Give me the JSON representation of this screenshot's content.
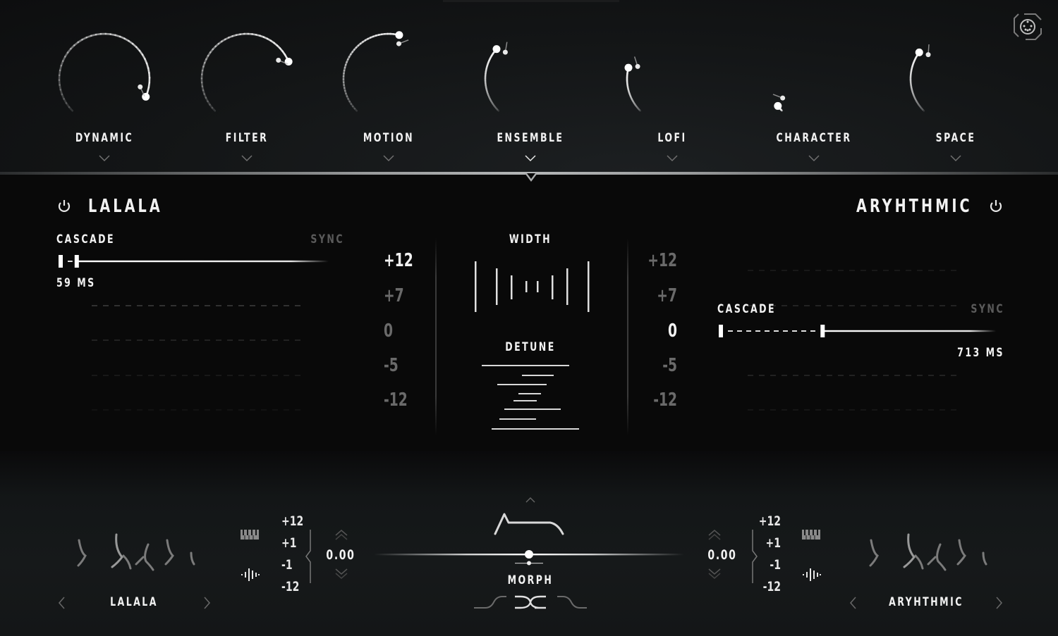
{
  "knobs": [
    {
      "label": "DYNAMIC",
      "value": 0.92,
      "secondary": 0.88
    },
    {
      "label": "FILTER",
      "value": 0.75,
      "secondary": 0.72
    },
    {
      "label": "MOTION",
      "value": 0.55,
      "secondary": 0.56
    },
    {
      "label": "ENSEMBLE",
      "value": 0.32,
      "secondary": 0.34
    },
    {
      "label": "LOFI",
      "value": 0.22,
      "secondary": 0.24
    },
    {
      "label": "CHARACTER",
      "value": 0.03,
      "secondary": 0.05
    },
    {
      "label": "SPACE",
      "value": 0.3,
      "secondary": 0.32
    }
  ],
  "selected_knob": "ENSEMBLE",
  "settings_icon": "midi-connector-icon",
  "left_layer": {
    "name": "LALALA",
    "power_icon": "power-icon",
    "cascade_label": "CASCADE",
    "sync_label": "SYNC",
    "cascade_value": "59 MS",
    "cascade_position": 0.06,
    "pitch_steps": [
      "+12",
      "+7",
      "0",
      "-5",
      "-12"
    ],
    "active_pitch": "+12"
  },
  "right_layer": {
    "name": "ARYHTHMIC",
    "power_icon": "power-icon",
    "cascade_label": "CASCADE",
    "sync_label": "SYNC",
    "cascade_value": "713 MS",
    "cascade_position": 0.37,
    "pitch_steps": [
      "+12",
      "+7",
      "0",
      "-5",
      "-12"
    ],
    "active_pitch": "0"
  },
  "center": {
    "width_label": "WIDTH",
    "detune_label": "DETUNE"
  },
  "bottom": {
    "left": {
      "preset_name": "LALALA",
      "prev_icon": "chevron-left-icon",
      "next_icon": "chevron-right-icon",
      "steps": [
        "+12",
        "+1",
        "-1",
        "-12"
      ],
      "value": "0.00",
      "keyboard_icon": "piano-keys-icon",
      "waveform_icon": "waveform-icon"
    },
    "right": {
      "preset_name": "ARYHTHMIC",
      "prev_icon": "chevron-left-icon",
      "next_icon": "chevron-right-icon",
      "steps": [
        "+12",
        "+1",
        "-1",
        "-12"
      ],
      "value": "0.00",
      "keyboard_icon": "piano-keys-icon",
      "waveform_icon": "waveform-icon"
    },
    "morph": {
      "label": "MORPH",
      "position": 0.5,
      "envelope_icon": "envelope-shape-icon",
      "crossfade_icon": "crossfade-icon"
    }
  }
}
